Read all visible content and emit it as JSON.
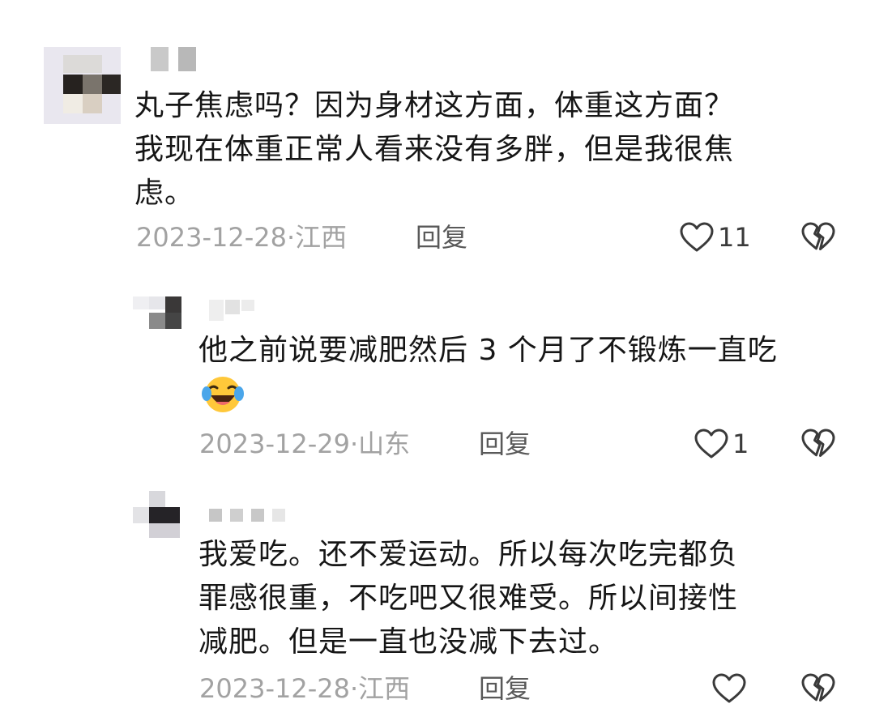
{
  "comments": [
    {
      "text": "丸子焦虑吗？因为身材这方面，体重这方面？\n我现在体重正常人看来没有多胖，但是我很焦\n虑。",
      "date": "2023-12-28",
      "separator": "·",
      "location": "江西",
      "reply_label": "回复",
      "likes": "11"
    },
    {
      "text": "他之前说要减肥然后 3 个月了不锻炼一直吃",
      "emoji": "laughing-crying-emoji",
      "date": "2023-12-29",
      "separator": "·",
      "location": "山东",
      "reply_label": "回复",
      "likes": "1"
    },
    {
      "text": "我爱吃。还不爱运动。所以每次吃完都负\n罪感很重，不吃吧又很难受。所以间接性\n减肥。但是一直也没减下去过。",
      "date": "2023-12-28",
      "separator": "·",
      "location": "江西",
      "reply_label": "回复",
      "likes": ""
    }
  ],
  "icons": {
    "like": "heart-outline-icon",
    "dislike": "broken-heart-icon"
  },
  "colors": {
    "text": "#161616",
    "meta": "#a2a2a2",
    "reply": "#595959",
    "icon": "#3a3a3a"
  }
}
